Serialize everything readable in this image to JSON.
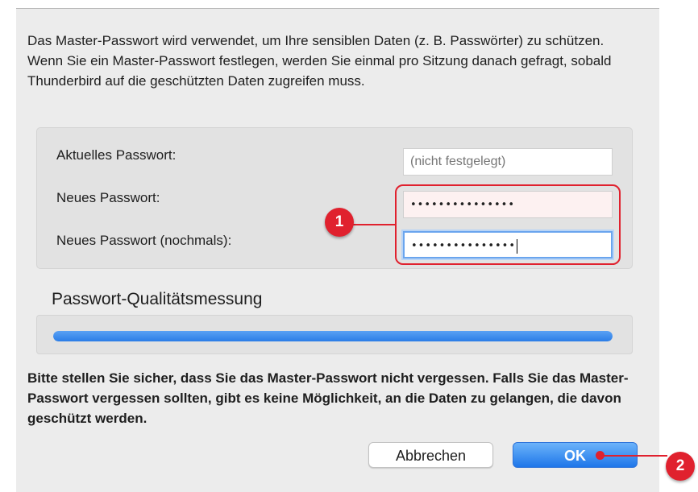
{
  "dialog": {
    "intro_text": "Das Master-Passwort wird verwendet, um Ihre sensiblen Daten (z. B. Passwörter) zu schützen. Wenn Sie ein Master-Passwort festlegen, werden Sie einmal pro Sitzung danach gefragt, sobald Thunderbird auf die geschützten Daten zugreifen muss.",
    "fields": {
      "current_label": "Aktuelles Passwort:",
      "current_placeholder": "(nicht festgelegt)",
      "new_label": "Neues Passwort:",
      "new_value": "•••••••••••••••",
      "confirm_label": "Neues Passwort (nochmals):",
      "confirm_value": "•••••••••••••••"
    },
    "quality": {
      "title": "Passwort-Qualitätsmessung",
      "level": 1.0
    },
    "warning_text": "Bitte stellen Sie sicher, dass Sie das Master-Passwort nicht vergessen. Falls Sie das Master-Passwort vergessen sollten, gibt es keine Möglichkeit, an die Daten zu gelangen, die davon geschützt werden.",
    "buttons": {
      "cancel": "Abbrechen",
      "ok": "OK"
    }
  },
  "annotations": {
    "badge_1": "1",
    "badge_2": "2"
  },
  "colors": {
    "annotation_red": "#e0212e",
    "accent_blue": "#2b7de7"
  }
}
